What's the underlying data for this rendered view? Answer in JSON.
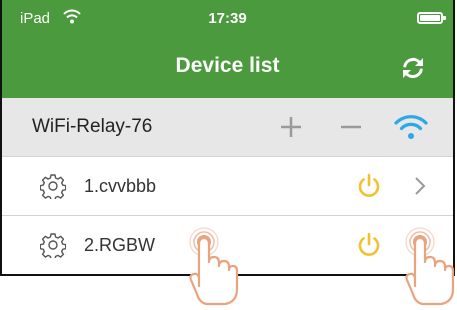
{
  "status_bar": {
    "carrier": "iPad",
    "time": "17:39"
  },
  "header": {
    "title": "Device list",
    "refresh_icon": "refresh-icon"
  },
  "group": {
    "name": "WiFi-Relay-76",
    "add_icon": "plus-icon",
    "remove_icon": "minus-icon",
    "wifi_icon": "wifi-icon"
  },
  "devices": [
    {
      "name": "1.cvvbbb"
    },
    {
      "name": "2.RGBW"
    }
  ],
  "colors": {
    "header_green": "#4c9a3e",
    "wifi_blue": "#2aa8e8",
    "power_yellow": "#f2c12e",
    "hand_orange": "#e9a37e"
  }
}
